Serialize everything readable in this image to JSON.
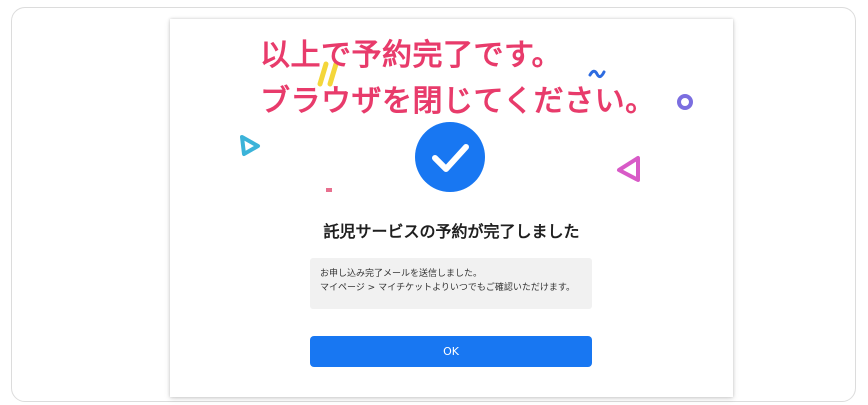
{
  "overlay": {
    "line1": "以上で予約完了です。",
    "line2": "ブラウザを閉じてください。"
  },
  "modal": {
    "title": "託児サービスの予約が完了しました",
    "message_line1": "お申し込み完了メールを送信しました。",
    "message_line2": "マイページ > マイチケットよりいつでもご確認いただけます。",
    "ok_label": "OK"
  },
  "colors": {
    "accent": "#1877f2",
    "caption": "#e83b6b"
  },
  "icons": {
    "success": "check-circle-icon"
  }
}
